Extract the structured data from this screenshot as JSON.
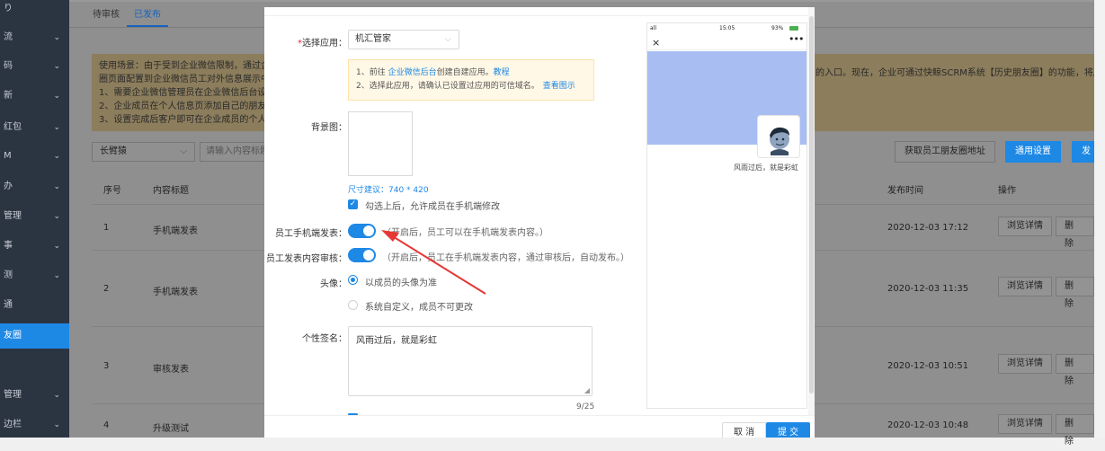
{
  "sidebar": {
    "items": [
      {
        "label": "り",
        "active": false
      },
      {
        "label": "流",
        "active": false
      },
      {
        "label": "码",
        "active": false
      },
      {
        "label": "新",
        "active": false
      },
      {
        "label": "红包",
        "active": false
      },
      {
        "label": "M",
        "active": false
      },
      {
        "label": "办",
        "active": false
      },
      {
        "label": "管理",
        "active": false
      },
      {
        "label": "事",
        "active": false
      },
      {
        "label": "测",
        "active": false
      },
      {
        "label": "通",
        "active": false
      },
      {
        "label": "友圈",
        "active": true
      },
      {
        "label": "管理",
        "active": false
      },
      {
        "label": "边栏",
        "active": false
      }
    ]
  },
  "tabs": [
    "待审核",
    "已发布"
  ],
  "notice": {
    "lines": [
      "使用场景：由于受到企业微信限制，通过企",
      "圈页面配置到企业微信员工对外信息展示中",
      "1、需要企业微信管理员在企业微信后台设置",
      "2、企业成员在个人信息页添加自己的朋友圈",
      "3、设置完成后客户即可在企业成员的个人信"
    ],
    "right_text": "的入口。现在，企业可通过快鲸SCRM系统【历史朋友圈】的功能，将朋"
  },
  "filter": {
    "select_value": "长臂猿",
    "input_placeholder": "请输入内容标题"
  },
  "toolbar": {
    "get_address": "获取员工朋友圈地址",
    "settings": "通用设置",
    "publish": "发"
  },
  "table": {
    "headers": {
      "index": "序号",
      "title": "内容标题",
      "time": "发布时间",
      "ops": "操作"
    },
    "rows": [
      {
        "index": "1",
        "title": "手机端发表",
        "time": "2020-12-03 17:12"
      },
      {
        "index": "2",
        "title": "手机端发表",
        "time": "2020-12-03 11:35"
      },
      {
        "index": "3",
        "title": "审核发表",
        "time": "2020-12-03 10:51"
      },
      {
        "index": "4",
        "title": "升级测试",
        "time": "2020-12-03 10:48"
      }
    ],
    "view_label": "浏览详情",
    "delete_label": "删 除"
  },
  "modal": {
    "app_label": "选择应用：",
    "app_value": "机汇管家",
    "tip": {
      "line1_prefix": "1、前往 ",
      "line1_link": "企业微信后台",
      "line1_mid": "创建自建应用。",
      "line1_link2": "教程",
      "line2_prefix": "2、选择此应用，请确认已设置过应用的可信域名。",
      "line2_link": "查看图示"
    },
    "bg_label": "背景图：",
    "size_hint": "尺寸建议：740 * 420",
    "allow_edit_label": "勾选上后，允许成员在手机端修改",
    "mobile_post_label": "员工手机端发表：",
    "mobile_post_hint": "（开启后，员工可以在手机端发表内容。）",
    "review_label": "员工发表内容审核：",
    "review_hint": "（开启后，员工在手机端发表内容，通过审核后，自动发布。）",
    "avatar_label": "头像：",
    "avatar_option1": "以成员的头像为准",
    "avatar_option2": "系统自定义，成员不可更改",
    "signature_label": "个性签名：",
    "signature_value": "风雨过后，就是彩虹",
    "signature_counter": "9/25",
    "cancel": "取 消",
    "submit": "提 交"
  },
  "phone": {
    "time": "15:05",
    "battery": "93%",
    "signal": "all",
    "signature": "风雨过后，就是彩虹"
  },
  "colors": {
    "primary": "#1e88e5",
    "sidebar_bg": "#2b3441",
    "arrow": "#e53935",
    "cover": "#a8bdf2"
  }
}
